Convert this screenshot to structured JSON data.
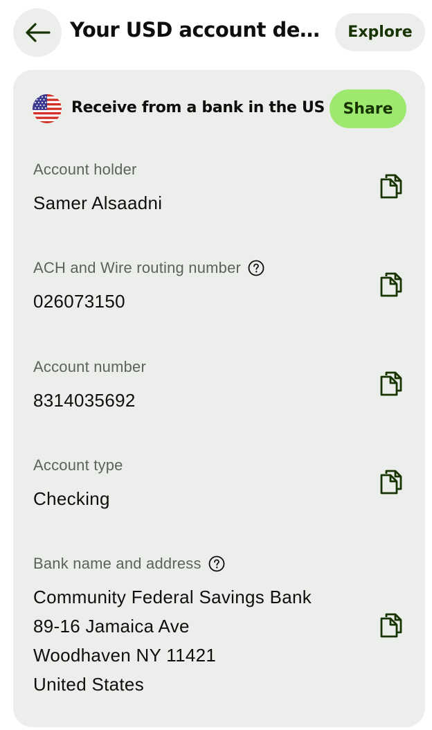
{
  "header": {
    "title": "Your USD account det...",
    "explore_label": "Explore"
  },
  "card": {
    "receive_label": "Receive from a bank in the US",
    "share_label": "Share",
    "flag_icon": "us-flag-icon",
    "fields": [
      {
        "label": "Account holder",
        "value_lines": [
          "Samer Alsaadni"
        ],
        "has_help": false
      },
      {
        "label": "ACH and Wire routing number",
        "value_lines": [
          "026073150"
        ],
        "has_help": true
      },
      {
        "label": "Account number",
        "value_lines": [
          "8314035692"
        ],
        "has_help": false
      },
      {
        "label": "Account type",
        "value_lines": [
          "Checking"
        ],
        "has_help": false
      },
      {
        "label": "Bank name and address",
        "value_lines": [
          "Community Federal Savings Bank",
          "89-16 Jamaica Ave",
          "Woodhaven NY 11421",
          "United States"
        ],
        "has_help": true
      }
    ]
  },
  "colors": {
    "accent_green": "#9fe870",
    "dark_green": "#163300",
    "card_bg": "#eceeeb"
  }
}
